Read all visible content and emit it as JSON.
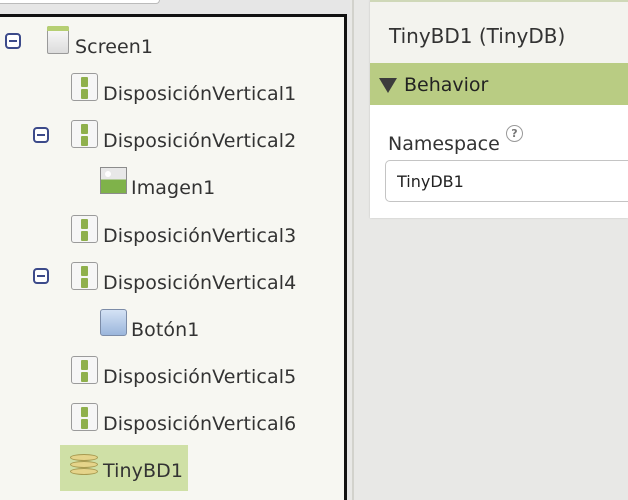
{
  "tree": {
    "items": [
      {
        "label": "Screen1",
        "icon": "screen-icon",
        "expanded": true
      },
      {
        "label": "DisposiciónVertical1",
        "icon": "vertical-arrangement-icon"
      },
      {
        "label": "DisposiciónVertical2",
        "icon": "vertical-arrangement-icon",
        "expanded": true
      },
      {
        "label": "Imagen1",
        "icon": "image-icon"
      },
      {
        "label": "DisposiciónVertical3",
        "icon": "vertical-arrangement-icon"
      },
      {
        "label": "DisposiciónVertical4",
        "icon": "vertical-arrangement-icon",
        "expanded": true
      },
      {
        "label": "Botón1",
        "icon": "button-icon"
      },
      {
        "label": "DisposiciónVertical5",
        "icon": "vertical-arrangement-icon"
      },
      {
        "label": "DisposiciónVertical6",
        "icon": "vertical-arrangement-icon"
      },
      {
        "label": "TinyBD1",
        "icon": "tinydb-icon",
        "selected": true
      }
    ]
  },
  "properties": {
    "title": "TinyBD1 (TinyDB)",
    "section": "Behavior",
    "namespace_label": "Namespace",
    "help_glyph": "?",
    "namespace_value": "TinyDB1"
  },
  "colors": {
    "selected": "#cfe0a6",
    "section_bar": "#b9cc83",
    "accent_green": "#8fb04c",
    "toggle_blue": "#3c4a8a"
  }
}
